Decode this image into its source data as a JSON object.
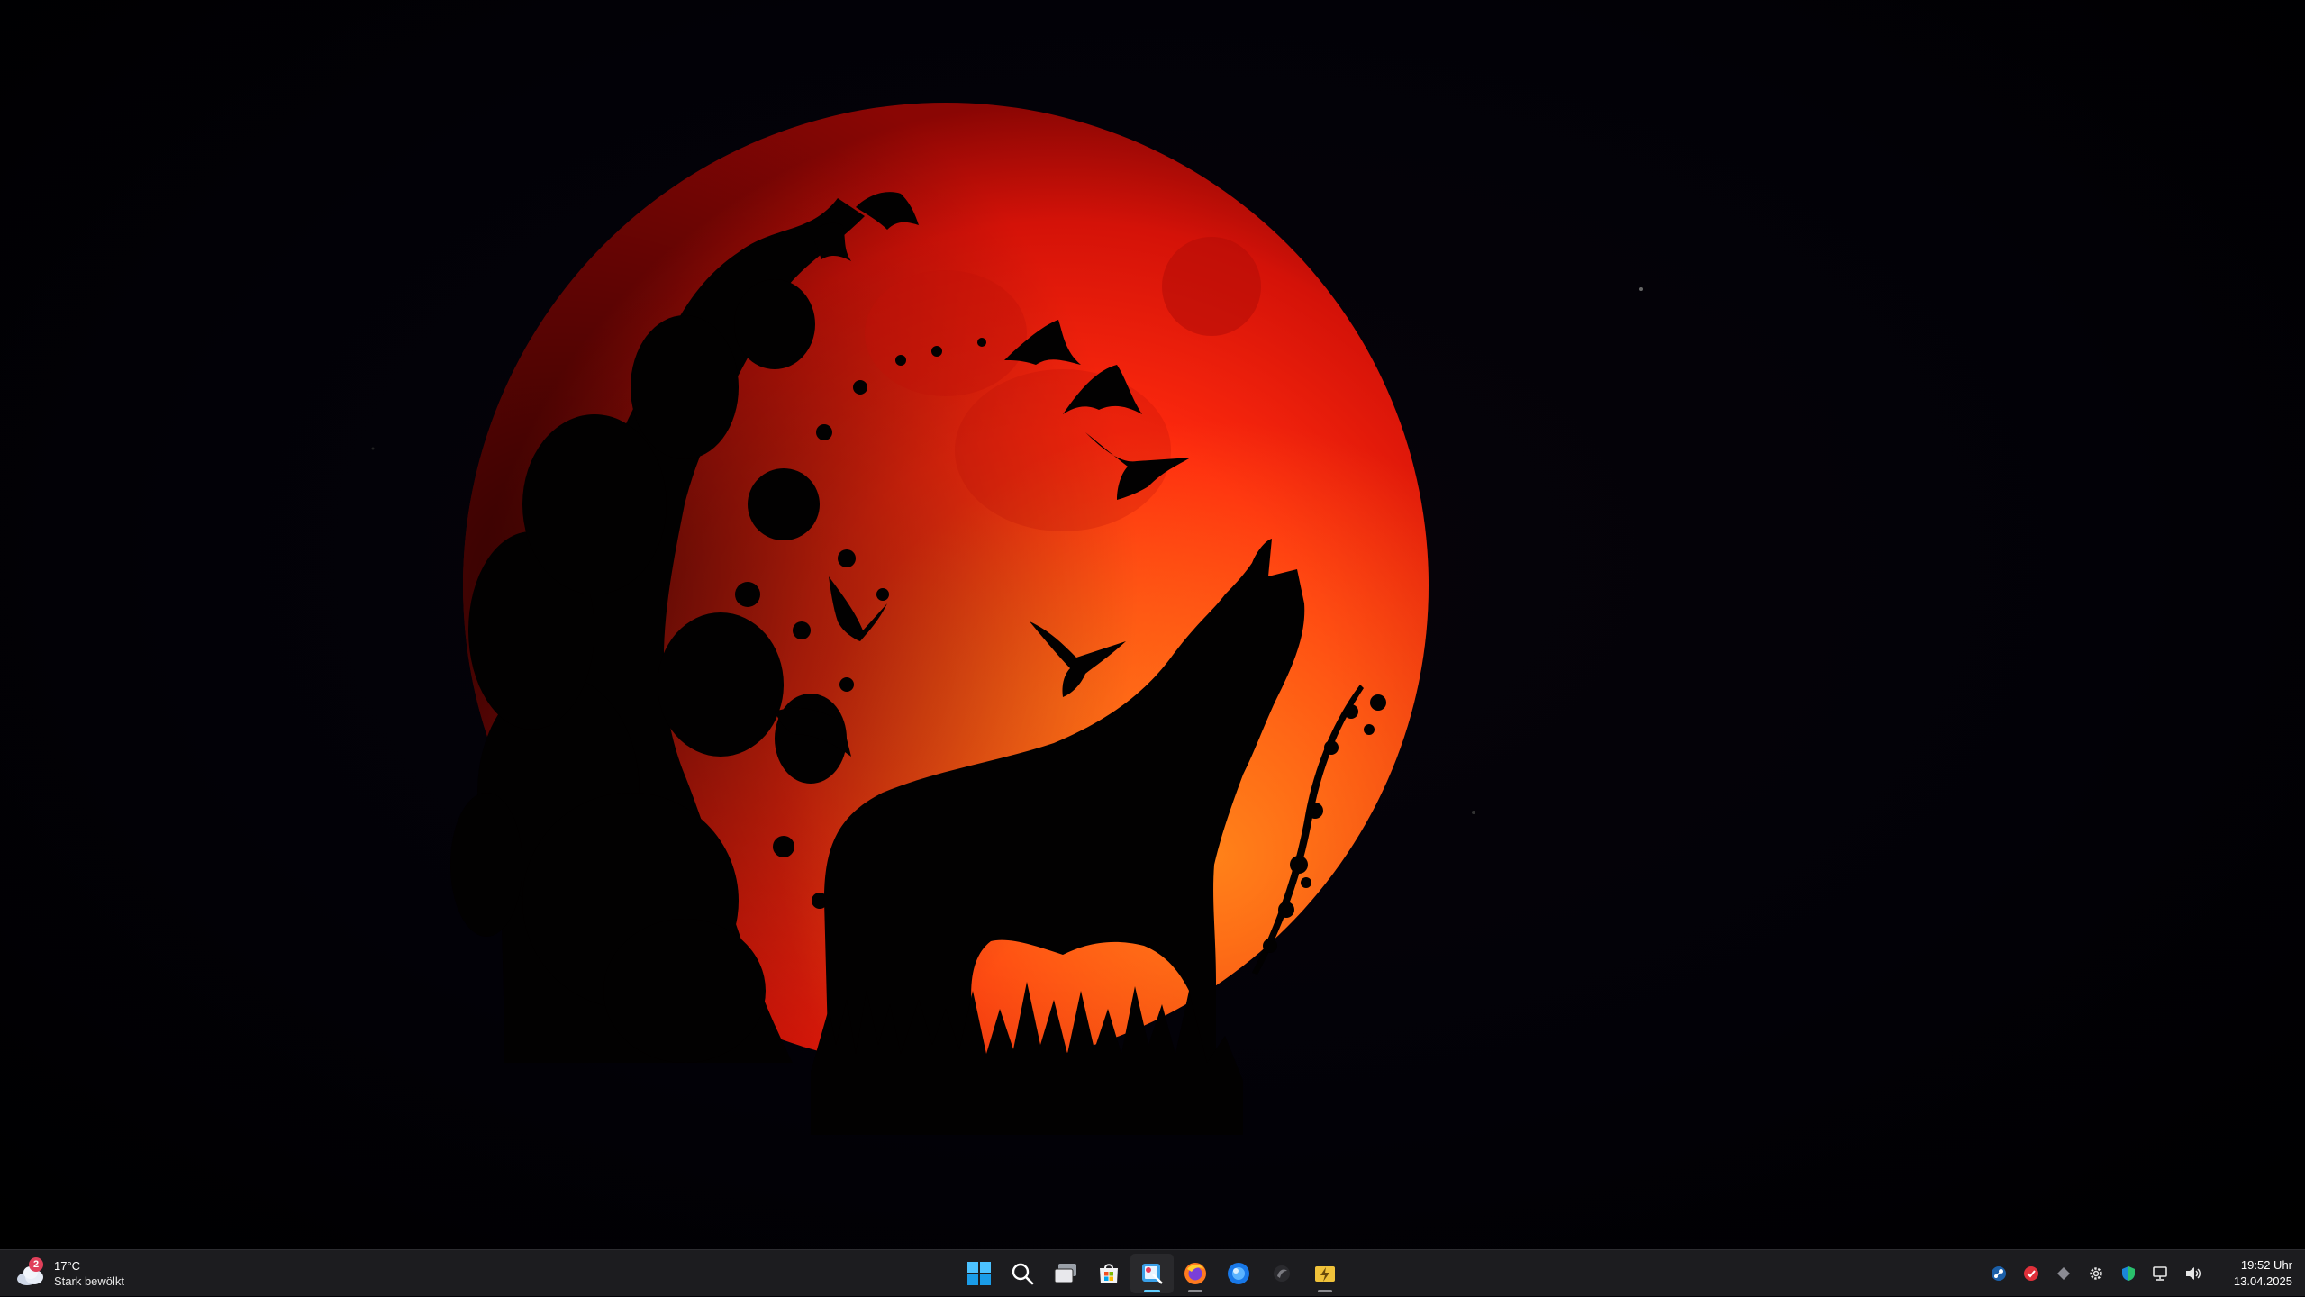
{
  "weather": {
    "badge_count": "2",
    "temperature": "17°C",
    "description": "Stark bewölkt",
    "icon": "cloudy-weather-icon"
  },
  "taskbar": {
    "pinned": [
      {
        "id": "start",
        "icon": "windows-start-icon",
        "active": false,
        "running": false
      },
      {
        "id": "search",
        "icon": "search-icon",
        "active": false,
        "running": false
      },
      {
        "id": "task-view",
        "icon": "task-view-icon",
        "active": false,
        "running": false
      },
      {
        "id": "store",
        "icon": "microsoft-store-icon",
        "active": false,
        "running": false
      },
      {
        "id": "snipping",
        "icon": "snipping-tool-icon",
        "active": true,
        "running": true
      },
      {
        "id": "firefox",
        "icon": "firefox-icon",
        "active": false,
        "running": true
      },
      {
        "id": "blue-app",
        "icon": "blue-globe-app-icon",
        "active": false,
        "running": false
      },
      {
        "id": "dark-app",
        "icon": "dark-app-icon",
        "active": false,
        "running": false
      },
      {
        "id": "folder-app",
        "icon": "lightning-folder-icon",
        "active": false,
        "running": true
      }
    ],
    "tray": [
      {
        "id": "steam",
        "icon": "steam-icon"
      },
      {
        "id": "antivirus",
        "icon": "red-shield-app-icon"
      },
      {
        "id": "diamond",
        "icon": "diamond-app-icon"
      },
      {
        "id": "settings-gear",
        "icon": "gear-tray-icon"
      },
      {
        "id": "defender",
        "icon": "security-shield-icon"
      },
      {
        "id": "network",
        "icon": "network-icon"
      },
      {
        "id": "volume",
        "icon": "speaker-icon"
      }
    ]
  },
  "clock": {
    "time": "19:52 Uhr",
    "date": "13.04.2025"
  },
  "colors": {
    "moon_core": "#ff2a10",
    "moon_edge": "#c30c08",
    "moon_glow_orange": "#ff7a10",
    "taskbar_bg": "#1c1c1f",
    "accent": "#60cdff"
  }
}
